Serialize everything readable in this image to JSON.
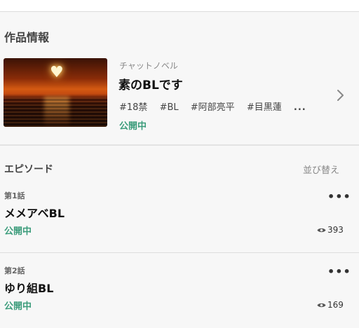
{
  "section": {
    "title": "作品情報"
  },
  "work": {
    "genre": "チャットノベル",
    "title": "素のBLです",
    "tags": [
      "#18禁",
      "#BL",
      "#阿部亮平",
      "#目黒蓮"
    ],
    "tags_more": "...",
    "status": "公開中"
  },
  "episodes_header": {
    "label": "エピソード",
    "sort_label": "並び替え"
  },
  "episodes": [
    {
      "number": "第1話",
      "title": "メメアベBL",
      "status": "公開中",
      "menu": "•••",
      "views": "393"
    },
    {
      "number": "第2話",
      "title": "ゆり組BL",
      "status": "公開中",
      "menu": "•••",
      "views": "169"
    }
  ],
  "colors": {
    "status": "#3b9c7b",
    "background": "#f7f7f7"
  },
  "icons": {
    "chevron": "chevron-right-icon",
    "views": "eye-icon",
    "menu": "more-icon"
  }
}
